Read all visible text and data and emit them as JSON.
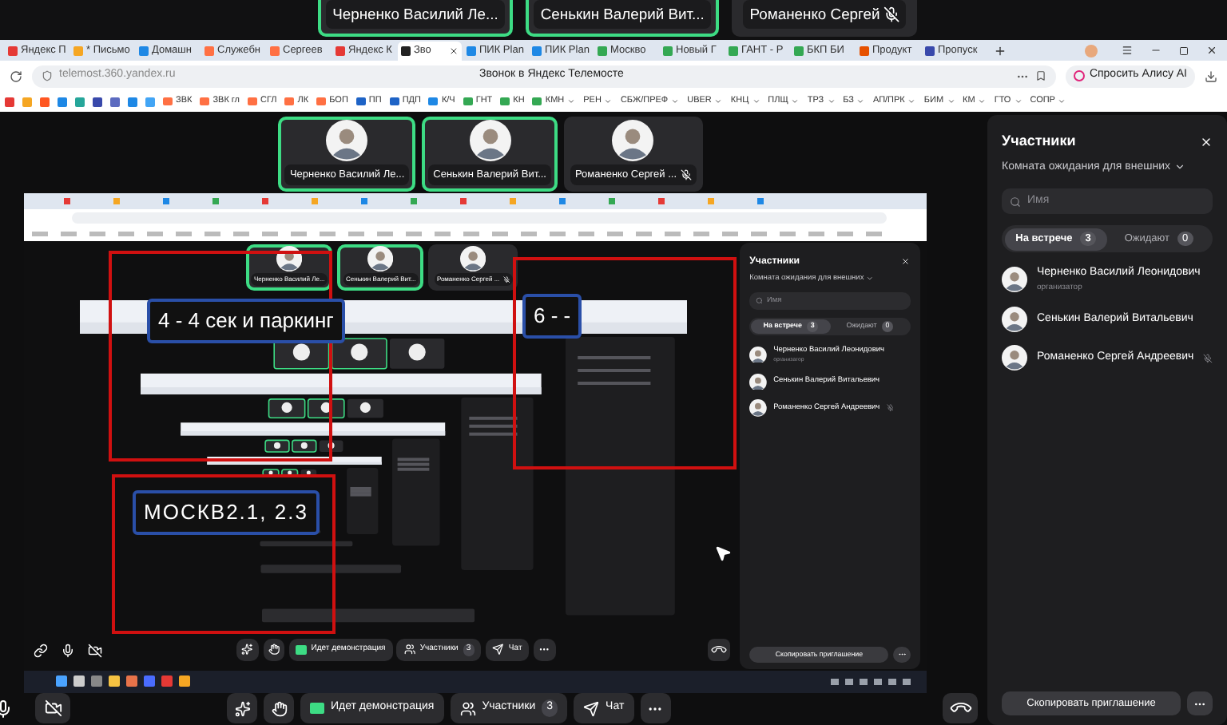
{
  "top_tiles": [
    {
      "name": "Черненко Василий Ле...",
      "speaking": true,
      "muted": false
    },
    {
      "name": "Сенькин Валерий Вит...",
      "speaking": true,
      "muted": false
    },
    {
      "name": "Романенко Сергей",
      "speaking": false,
      "muted": true
    }
  ],
  "browser": {
    "tabs": [
      {
        "label": "Яндекс П",
        "selected": false,
        "color": "#e53935"
      },
      {
        "label": "* Письмо",
        "selected": false,
        "color": "#f5a623"
      },
      {
        "label": "Домашн",
        "selected": false,
        "color": "#1e88e5"
      },
      {
        "label": "Служебн",
        "selected": false,
        "color": "#ff7043"
      },
      {
        "label": "Сергеев",
        "selected": false,
        "color": "#ff7043"
      },
      {
        "label": "Яндекс К",
        "selected": false,
        "color": "#e53935"
      },
      {
        "label": "Зво",
        "selected": true,
        "color": "#222222"
      },
      {
        "label": "ПИК Plan",
        "selected": false,
        "color": "#1e88e5"
      },
      {
        "label": "ПИК Plan",
        "selected": false,
        "color": "#1e88e5"
      },
      {
        "label": "Москво",
        "selected": false,
        "color": "#34a853"
      },
      {
        "label": "Новый Г",
        "selected": false,
        "color": "#34a853"
      },
      {
        "label": "ГАНТ - Р",
        "selected": false,
        "color": "#34a853"
      },
      {
        "label": "БКП БИ",
        "selected": false,
        "color": "#34a853"
      },
      {
        "label": "Продукт",
        "selected": false,
        "color": "#e65100"
      },
      {
        "label": "Пропуск",
        "selected": false,
        "color": "#3949ab"
      }
    ],
    "address": "telemost.360.yandex.ru",
    "page_title": "Звонок в Яндекс Телемосте",
    "alice_button": "Спросить Алису AI",
    "icon_bookmarks": [
      {
        "color": "#e53935"
      },
      {
        "color": "#f5a623"
      },
      {
        "color": "#ff5722"
      },
      {
        "color": "#1e88e5"
      },
      {
        "color": "#26a69a"
      },
      {
        "color": "#3949ab"
      },
      {
        "color": "#5c6bc0"
      },
      {
        "color": "#1e88e5"
      },
      {
        "color": "#42a5f5"
      }
    ],
    "bookmarks": [
      {
        "label": "ЗВК",
        "color": "#ff7043",
        "dropdown": false
      },
      {
        "label": "ЗВК гл",
        "color": "#ff7043",
        "dropdown": false
      },
      {
        "label": "СГЛ",
        "color": "#ff7043",
        "dropdown": false
      },
      {
        "label": "ЛК",
        "color": "#ff7043",
        "dropdown": false
      },
      {
        "label": "БОП",
        "color": "#ff7043",
        "dropdown": false
      },
      {
        "label": "ПП",
        "color": "#1e63c6",
        "dropdown": false
      },
      {
        "label": "ПДП",
        "color": "#1e63c6",
        "dropdown": false
      },
      {
        "label": "К/Ч",
        "color": "#1e88e5",
        "dropdown": false
      },
      {
        "label": "ГНТ",
        "color": "#34a853",
        "dropdown": false
      },
      {
        "label": "КН",
        "color": "#34a853",
        "dropdown": false
      },
      {
        "label": "КМН",
        "color": "#34a853",
        "dropdown": true
      },
      {
        "label": "РЕН",
        "dropdown": true
      },
      {
        "label": "СБЖ/ПРЕФ",
        "dropdown": true
      },
      {
        "label": "UBER",
        "dropdown": true
      },
      {
        "label": "КНЦ",
        "dropdown": true
      },
      {
        "label": "ПЛЩ",
        "dropdown": true
      },
      {
        "label": "ТРЗ",
        "dropdown": true
      },
      {
        "label": "БЗ",
        "dropdown": true
      },
      {
        "label": "АП/ПРК",
        "dropdown": true
      },
      {
        "label": "БИМ",
        "dropdown": true
      },
      {
        "label": "КМ",
        "dropdown": true
      },
      {
        "label": "ГТО",
        "dropdown": true
      },
      {
        "label": "СОПР",
        "dropdown": true
      }
    ]
  },
  "call": {
    "tiles": [
      {
        "name": "Черненко Василий Ле...",
        "speaking": true,
        "muted": false
      },
      {
        "name": "Сенькин Валерий Вит...",
        "speaking": true,
        "muted": false
      },
      {
        "name": "Романенко Сергей ...",
        "speaking": false,
        "muted": true
      }
    ],
    "shared_screen": {
      "tiles": [
        {
          "name": "Черненко Василий Ле...",
          "speaking": true,
          "muted": false
        },
        {
          "name": "Сенькин Валерий Вит...",
          "speaking": true,
          "muted": false
        },
        {
          "name": "Романенко Сергей ...",
          "speaking": false,
          "muted": true
        }
      ],
      "annotations": [
        {
          "text": "4 - 4 сек и паркинг"
        },
        {
          "text": "6 - -"
        },
        {
          "text": "МОСКВ2.1, 2.3"
        }
      ],
      "panel": {
        "title": "Участники",
        "room": "Комната ожидания для внешних",
        "search_placeholder": "Имя",
        "segments": [
          {
            "label": "На встрече",
            "count": "3",
            "selected": true
          },
          {
            "label": "Ожидают",
            "count": "0",
            "selected": false
          }
        ],
        "participants": [
          {
            "name": "Черненко Василий Леонидович",
            "role": "организатор",
            "muted": false
          },
          {
            "name": "Сенькин Валерий Витальевич",
            "muted": false
          },
          {
            "name": "Романенко Сергей Андреевич",
            "muted": true
          }
        ],
        "invite_button": "Скопировать приглашение"
      },
      "toolbar": {
        "demo_button": "Идет демонстрация",
        "participants_button": "Участники",
        "participants_count": "3",
        "chat_button": "Чат"
      }
    },
    "toolbar": {
      "demo_button": "Идет демонстрация",
      "participants_button": "Участники",
      "participants_count": "3",
      "chat_button": "Чат"
    }
  },
  "panel": {
    "title": "Участники",
    "room": "Комната ожидания для внешних",
    "search_placeholder": "Имя",
    "segments": [
      {
        "label": "На встрече",
        "count": "3",
        "selected": true
      },
      {
        "label": "Ожидают",
        "count": "0",
        "selected": false
      }
    ],
    "participants": [
      {
        "name": "Черненко Василий Леонидович",
        "role": "организатор",
        "muted": false
      },
      {
        "name": "Сенькин Валерий Витальевич",
        "muted": false
      },
      {
        "name": "Романенко Сергей Андреевич",
        "muted": true
      }
    ],
    "invite_button": "Скопировать приглашение"
  }
}
